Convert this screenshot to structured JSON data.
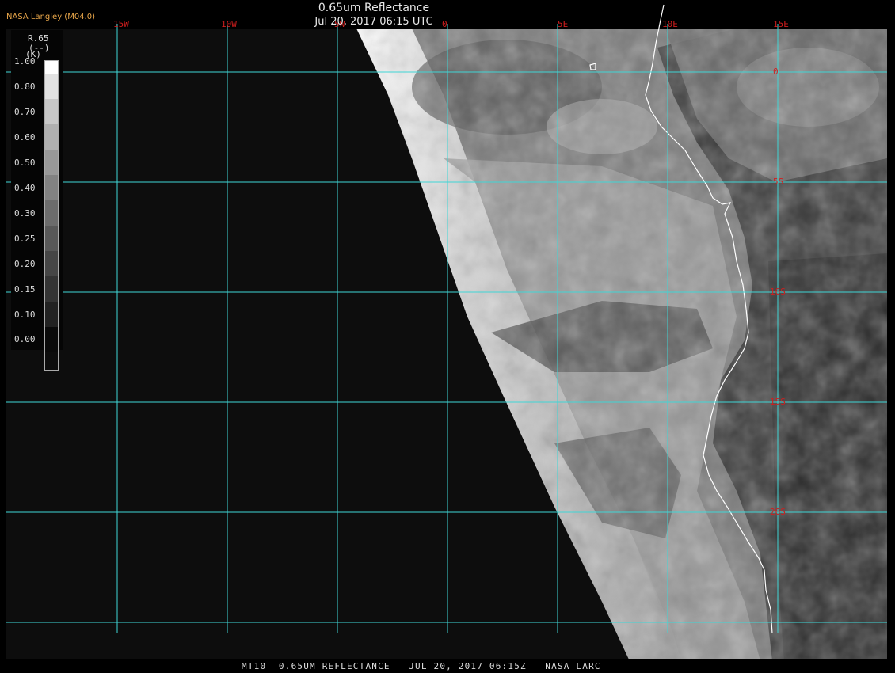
{
  "header": {
    "title": "0.65um Reflectance",
    "subtitle": "Jul 20, 2017 06:15 UTC",
    "credit": "NASA Langley (M04.0)"
  },
  "legend": {
    "variable": "R.65",
    "unit": "(--)",
    "k_marker": "(K)",
    "ticks": [
      "1.00",
      "0.80",
      "0.70",
      "0.60",
      "0.50",
      "0.40",
      "0.30",
      "0.25",
      "0.20",
      "0.15",
      "0.10",
      "0.00"
    ]
  },
  "grid": {
    "lon_labels": [
      "15W",
      "10W",
      "5W",
      "0",
      "5E",
      "10E",
      "15E"
    ],
    "lat_labels": [
      "0",
      "5S",
      "10S",
      "15S",
      "20S"
    ]
  },
  "footer": {
    "text": "MT10  0.65UM REFLECTANCE   JUL 20, 2017 06:15Z   NASA LARC"
  },
  "colors": {
    "grid": "#3fd6d6",
    "grid_label": "#d21e1e",
    "coastline": "#ffffff",
    "space": "#0d0d0d"
  }
}
